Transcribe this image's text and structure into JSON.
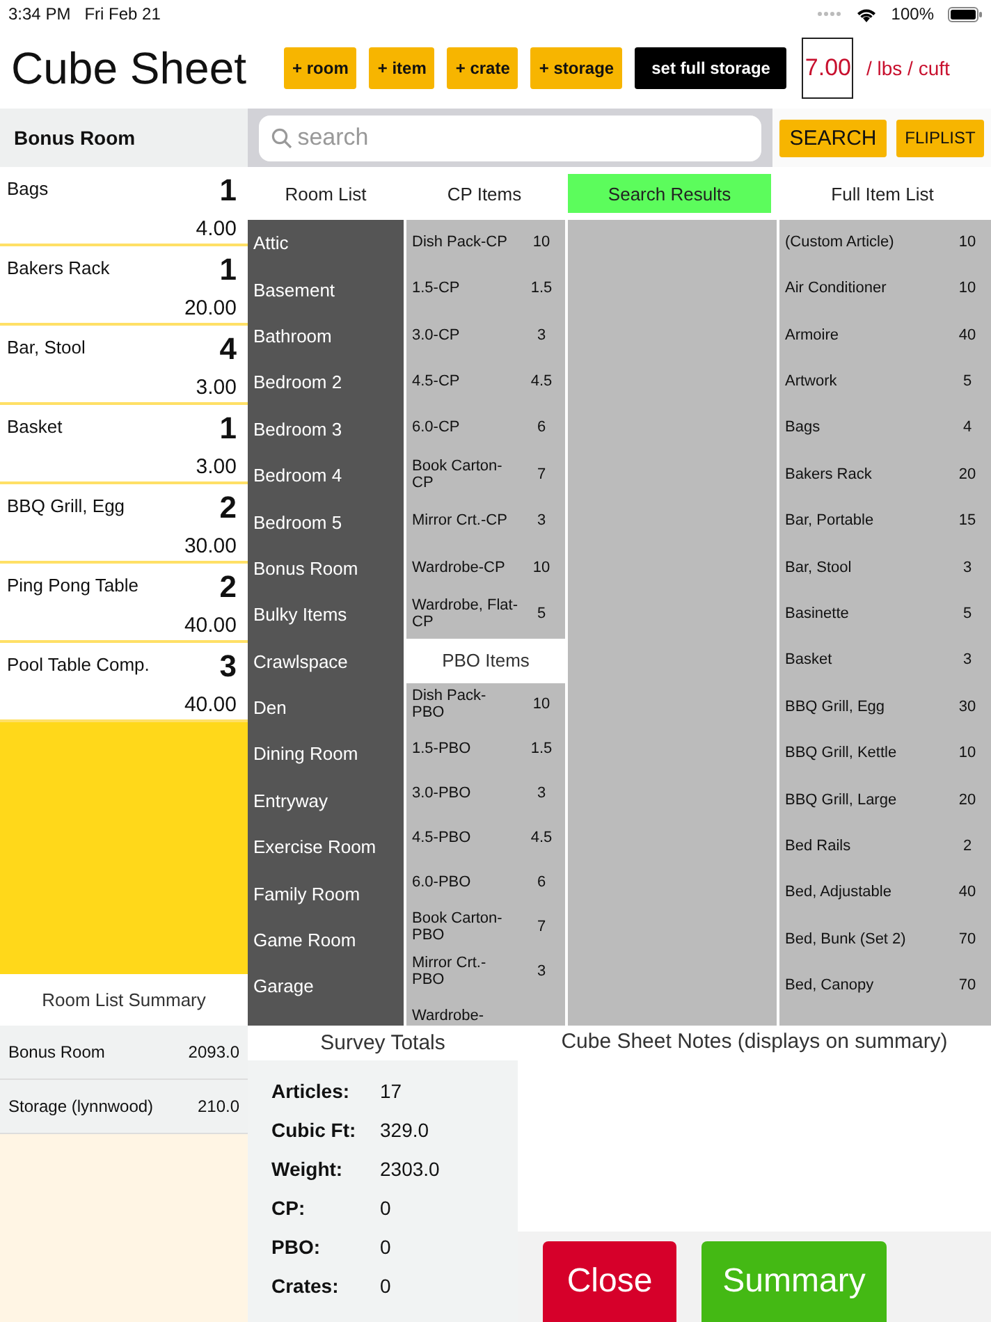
{
  "status_bar": {
    "time": "3:34 PM",
    "date": "Fri Feb 21",
    "battery": "100%"
  },
  "header": {
    "title": "Cube Sheet",
    "buttons": [
      {
        "label": "+ room",
        "kind": "add"
      },
      {
        "label": "+ item",
        "kind": "add"
      },
      {
        "label": "+ crate",
        "kind": "add"
      },
      {
        "label": "+ storage",
        "kind": "add"
      },
      {
        "label": "set full storage",
        "kind": "dark"
      }
    ],
    "weight_factor": "7.00",
    "weight_unit": "/ lbs / cuft"
  },
  "current_room": "Bonus Room",
  "search": {
    "placeholder": "search"
  },
  "search_buttons": [
    {
      "label": "SEARCH",
      "kind": "large"
    },
    {
      "label": "FLIPLIST",
      "kind": "small"
    }
  ],
  "room_items": [
    {
      "name": "Bags",
      "quantity": "1",
      "cubic_ft": "4.00"
    },
    {
      "name": "Bakers Rack",
      "quantity": "1",
      "cubic_ft": "20.00"
    },
    {
      "name": "Bar, Stool",
      "quantity": "4",
      "cubic_ft": "3.00"
    },
    {
      "name": "Basket",
      "quantity": "1",
      "cubic_ft": "3.00"
    },
    {
      "name": "BBQ Grill, Egg",
      "quantity": "2",
      "cubic_ft": "30.00"
    },
    {
      "name": "Ping Pong Table",
      "quantity": "2",
      "cubic_ft": "40.00"
    },
    {
      "name": "Pool Table Comp.",
      "quantity": "3",
      "cubic_ft": "40.00"
    }
  ],
  "tabs": [
    {
      "label": "Room List",
      "selected": false
    },
    {
      "label": "CP Items",
      "selected": false
    },
    {
      "label": "Search Results",
      "selected": true
    },
    {
      "label": "Full Item List",
      "selected": false
    }
  ],
  "room_list": [
    "Attic",
    "Basement",
    "Bathroom",
    "Bedroom 2",
    "Bedroom 3",
    "Bedroom 4",
    "Bedroom 5",
    "Bonus Room",
    "Bulky Items",
    "Crawlspace",
    "Den",
    "Dining Room",
    "Entryway",
    "Exercise Room",
    "Family Room",
    "Game Room",
    "Garage"
  ],
  "cp_items": [
    {
      "name": "Dish Pack-CP",
      "cuft": "10"
    },
    {
      "name": "1.5-CP",
      "cuft": "1.5"
    },
    {
      "name": "3.0-CP",
      "cuft": "3"
    },
    {
      "name": "4.5-CP",
      "cuft": "4.5"
    },
    {
      "name": "6.0-CP",
      "cuft": "6"
    },
    {
      "name": "Book Carton-CP",
      "cuft": "7"
    },
    {
      "name": "Mirror Crt.-CP",
      "cuft": "3"
    },
    {
      "name": "Wardrobe-CP",
      "cuft": "10"
    },
    {
      "name": "Wardrobe, Flat-CP",
      "cuft": "5"
    }
  ],
  "pbo_header": "PBO Items",
  "pbo_items": [
    {
      "name": "Dish Pack-PBO",
      "cuft": "10"
    },
    {
      "name": "1.5-PBO",
      "cuft": "1.5"
    },
    {
      "name": "3.0-PBO",
      "cuft": "3"
    },
    {
      "name": "4.5-PBO",
      "cuft": "4.5"
    },
    {
      "name": "6.0-PBO",
      "cuft": "6"
    },
    {
      "name": "Book Carton-PBO",
      "cuft": "7"
    },
    {
      "name": "Mirror Crt.-PBO",
      "cuft": "3"
    },
    {
      "name": "Wardrobe-"
    }
  ],
  "full_item_list": [
    {
      "name": "(Custom Article)",
      "cuft": "10"
    },
    {
      "name": "Air Conditioner",
      "cuft": "10"
    },
    {
      "name": "Armoire",
      "cuft": "40"
    },
    {
      "name": "Artwork",
      "cuft": "5"
    },
    {
      "name": "Bags",
      "cuft": "4"
    },
    {
      "name": "Bakers Rack",
      "cuft": "20"
    },
    {
      "name": "Bar, Portable",
      "cuft": "15"
    },
    {
      "name": "Bar, Stool",
      "cuft": "3"
    },
    {
      "name": "Basinette",
      "cuft": "5"
    },
    {
      "name": "Basket",
      "cuft": "3"
    },
    {
      "name": "BBQ Grill, Egg",
      "cuft": "30"
    },
    {
      "name": "BBQ Grill, Kettle",
      "cuft": "10"
    },
    {
      "name": "BBQ Grill, Large",
      "cuft": "20"
    },
    {
      "name": "Bed Rails",
      "cuft": "2"
    },
    {
      "name": "Bed, Adjustable",
      "cuft": "40"
    },
    {
      "name": "Bed, Bunk (Set 2)",
      "cuft": "70"
    },
    {
      "name": "Bed, Canopy",
      "cuft": "70"
    }
  ],
  "room_list_summary": {
    "title": "Room List Summary",
    "rooms": [
      {
        "name": "Bonus Room",
        "cubic_ft": "2093.0"
      },
      {
        "name": "Storage (lynnwood)",
        "cubic_ft": "210.0"
      }
    ]
  },
  "survey_totals": {
    "title": "Survey Totals",
    "rows": [
      {
        "label": "Articles:",
        "value": "17"
      },
      {
        "label": "Cubic Ft:",
        "value": "329.0"
      },
      {
        "label": "Weight:",
        "value": "2303.0"
      },
      {
        "label": "CP:",
        "value": "0"
      },
      {
        "label": "PBO:",
        "value": "0"
      },
      {
        "label": "Crates:",
        "value": "0"
      }
    ]
  },
  "notes": {
    "title": "Cube Sheet Notes (displays on summary)"
  },
  "actions": [
    {
      "label": "Close",
      "kind": "danger"
    },
    {
      "label": "Summary",
      "kind": "primary"
    }
  ]
}
